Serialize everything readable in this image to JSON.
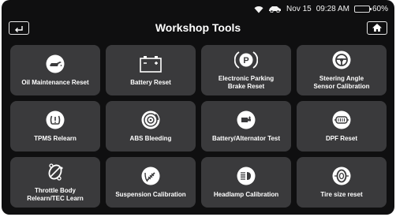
{
  "status": {
    "date": "Nov 15",
    "time": "09:28 AM",
    "battery_level": "60%",
    "battery_fraction": 0.6
  },
  "header": {
    "title": "Workshop Tools",
    "back_icon": "back-arrow-icon",
    "home_icon": "home-icon"
  },
  "tools": [
    {
      "label": "Oil Maintenance Reset",
      "icon": "oil-can-icon"
    },
    {
      "label": "Battery Reset",
      "icon": "battery-icon"
    },
    {
      "label": "Electronic Parking\nBrake Reset",
      "icon": "parking-brake-icon"
    },
    {
      "label": "Steering Angle\nSensor Calibration",
      "icon": "steering-wheel-icon"
    },
    {
      "label": "TPMS Relearn",
      "icon": "tire-pressure-icon"
    },
    {
      "label": "ABS Bleeding",
      "icon": "brake-disc-icon"
    },
    {
      "label": "Battery/Alternator Test",
      "icon": "battery-test-icon"
    },
    {
      "label": "DPF Reset",
      "icon": "dpf-filter-icon"
    },
    {
      "label": "Throttle Body\nRelearn/TEC Learn",
      "icon": "throttle-icon"
    },
    {
      "label": "Suspension Calibration",
      "icon": "suspension-icon"
    },
    {
      "label": "Headlamp Calibration",
      "icon": "headlamp-icon"
    },
    {
      "label": "Tire size reset",
      "icon": "tire-icon"
    }
  ]
}
